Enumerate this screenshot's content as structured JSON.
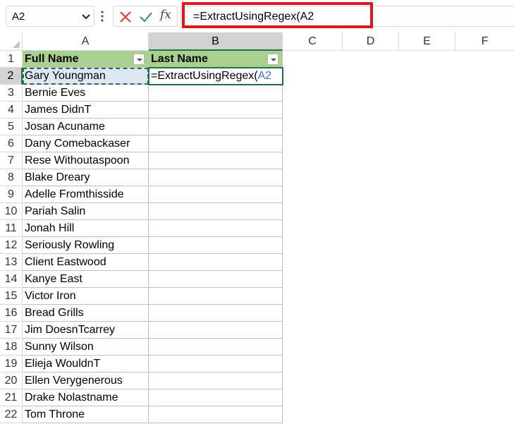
{
  "formula_bar": {
    "name_box": "A2",
    "formula": "=ExtractUsingRegex(A2",
    "fx_label": "fx"
  },
  "columns": [
    "A",
    "B",
    "C",
    "D",
    "E",
    "F"
  ],
  "table": {
    "header": {
      "col_a": "Full Name",
      "col_b": "Last Name"
    }
  },
  "rows": [
    {
      "num": "1"
    },
    {
      "num": "2",
      "name": "Gary Youngman",
      "formula_prefix": "=ExtractUsingRegex(",
      "formula_ref": "A2"
    },
    {
      "num": "3",
      "name": "Bernie Eves"
    },
    {
      "num": "4",
      "name": "James DidnT"
    },
    {
      "num": "5",
      "name": "Josan Acuname"
    },
    {
      "num": "6",
      "name": "Dany Comebackaser"
    },
    {
      "num": "7",
      "name": "Rese Withoutaspoon"
    },
    {
      "num": "8",
      "name": "Blake Dreary"
    },
    {
      "num": "9",
      "name": "Adelle Fromthisside"
    },
    {
      "num": "10",
      "name": "Pariah Salin"
    },
    {
      "num": "11",
      "name": "Jonah Hill"
    },
    {
      "num": "12",
      "name": "Seriously Rowling"
    },
    {
      "num": "13",
      "name": "Client Eastwood"
    },
    {
      "num": "14",
      "name": "Kanye East"
    },
    {
      "num": "15",
      "name": "Victor Iron"
    },
    {
      "num": "16",
      "name": "Bread Grills"
    },
    {
      "num": "17",
      "name": "Jim DoesnTcarrey"
    },
    {
      "num": "18",
      "name": "Sunny Wilson"
    },
    {
      "num": "19",
      "name": "Elieja WouldnT"
    },
    {
      "num": "20",
      "name": "Ellen Verygenerous"
    },
    {
      "num": "21",
      "name": "Drake Nolastname"
    },
    {
      "num": "22",
      "name": "Tom Throne"
    }
  ],
  "colors": {
    "header_fill": "#a9d08e",
    "accent_green": "#217346",
    "highlight_red": "#e0161e",
    "reference_blue": "#4472c4"
  },
  "icons": [
    "chevron-down-icon",
    "more-dots-icon",
    "cancel-x-icon",
    "enter-check-icon",
    "function-fx-icon",
    "filter-dropdown-icon"
  ]
}
